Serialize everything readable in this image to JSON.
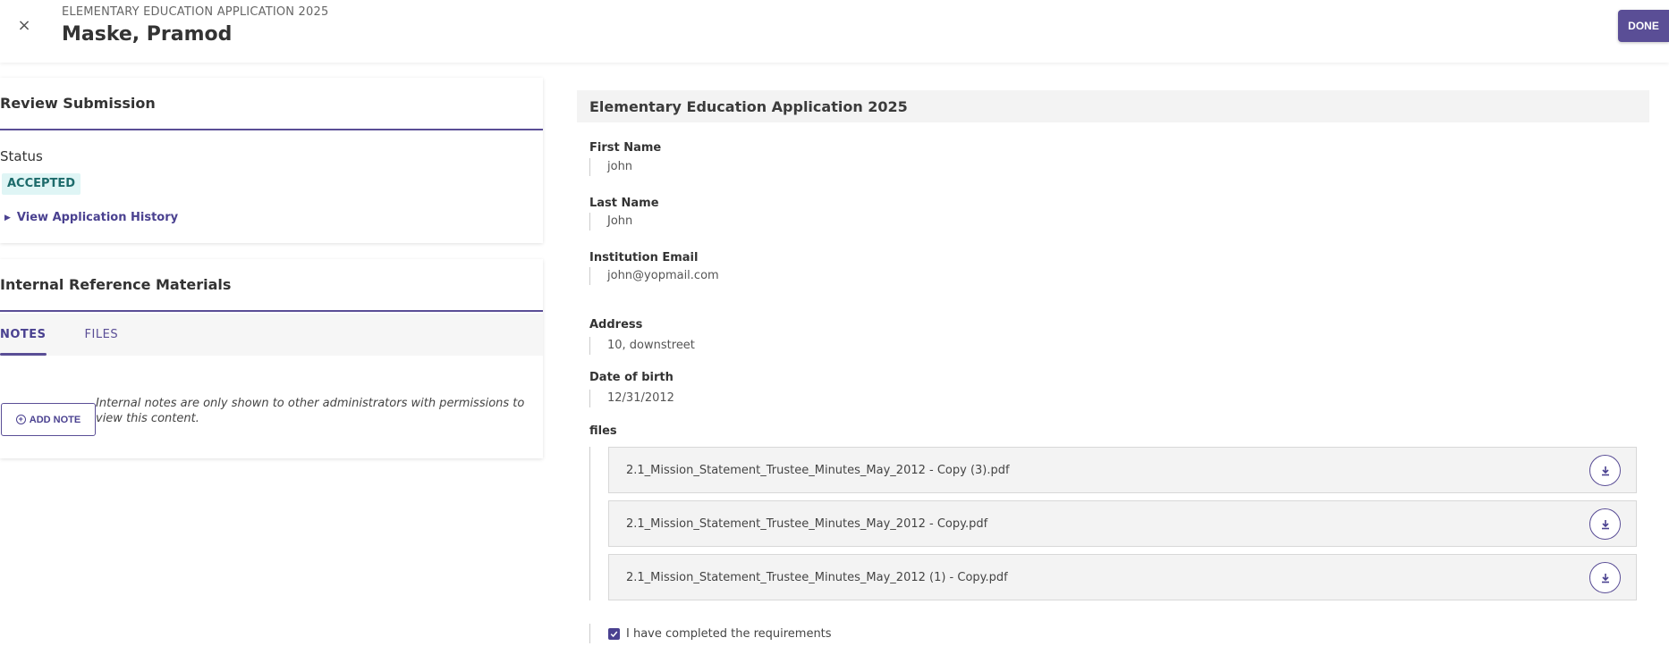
{
  "header": {
    "close_glyph": "×",
    "kicker": "ELEMENTARY EDUCATION APPLICATION 2025",
    "title": "Maske, Pramod",
    "done_label": "DONE"
  },
  "review": {
    "title": "Review Submission",
    "status_label": "Status",
    "status_value": "ACCEPTED",
    "history_link": "View Application History"
  },
  "internal": {
    "title": "Internal Reference Materials",
    "tabs": [
      {
        "label": "NOTES",
        "active": true
      },
      {
        "label": "FILES",
        "active": false
      }
    ],
    "add_note_label": "ADD NOTE",
    "help_text": "Internal notes are only shown to other administrators with permissions to view this content."
  },
  "form": {
    "title": "Elementary Education Application 2025",
    "fields": [
      {
        "label": "First Name",
        "value": "john"
      },
      {
        "label": "Last Name",
        "value": "John"
      },
      {
        "label": "Institution Email",
        "value": "john@yopmail.com"
      },
      {
        "label": "Address",
        "value": "10, downstreet"
      },
      {
        "label": "Date of birth",
        "value": "12/31/2012"
      }
    ],
    "files_label": "files",
    "files": [
      {
        "name": "2.1_Mission_Statement_Trustee_Minutes_May_2012 - Copy (3).pdf"
      },
      {
        "name": "2.1_Mission_Statement_Trustee_Minutes_May_2012 - Copy.pdf"
      },
      {
        "name": "2.1_Mission_Statement_Trustee_Minutes_May_2012 (1) - Copy.pdf"
      }
    ],
    "requirement_label": "I have completed the requirements",
    "requirement_checked": true
  },
  "colors": {
    "accent": "#5a4e96",
    "status_bg": "#dff5f5",
    "status_fg": "#1d6b6b"
  }
}
